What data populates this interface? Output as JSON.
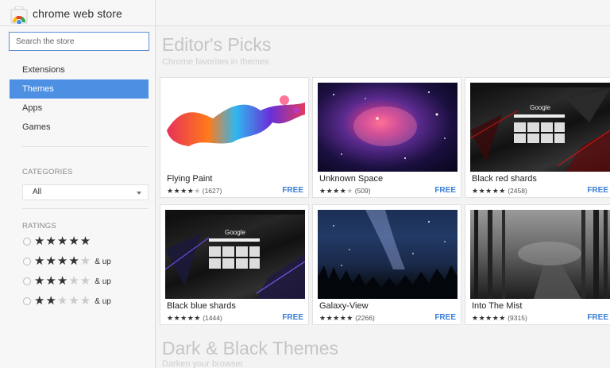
{
  "app": {
    "title": "chrome web store"
  },
  "search": {
    "placeholder": "Search the store"
  },
  "sidebar": {
    "nav": [
      "Extensions",
      "Themes",
      "Apps",
      "Games"
    ],
    "active_index": 1,
    "categories_label": "CATEGORIES",
    "category_selected": "All",
    "ratings_label": "RATINGS",
    "ratings": [
      {
        "stars": 5,
        "label": ""
      },
      {
        "stars": 4,
        "label": "& up"
      },
      {
        "stars": 3,
        "label": "& up"
      },
      {
        "stars": 2,
        "label": "& up"
      }
    ]
  },
  "sections": [
    {
      "title": "Editor's Picks",
      "subtitle": "Chrome favorites in themes"
    },
    {
      "title": "Dark & Black Themes",
      "subtitle": "Darken your browser"
    }
  ],
  "cards": [
    {
      "name": "Flying Paint",
      "rating": 4,
      "count": "(1627)",
      "price": "FREE",
      "thumb": "flying-paint-thumbnail"
    },
    {
      "name": "Unknown Space",
      "rating": 4,
      "count": "(509)",
      "price": "FREE",
      "thumb": "unknown-space-thumbnail"
    },
    {
      "name": "Black red shards",
      "rating": 4.5,
      "count": "(2458)",
      "price": "FREE",
      "thumb": "black-red-shards-thumbnail"
    },
    {
      "name": "Black blue shards",
      "rating": 4.5,
      "count": "(1444)",
      "price": "FREE",
      "thumb": "black-blue-shards-thumbnail"
    },
    {
      "name": "Galaxy-View",
      "rating": 4.5,
      "count": "(2266)",
      "price": "FREE",
      "thumb": "galaxy-view-thumbnail"
    },
    {
      "name": "Into The Mist",
      "rating": 5,
      "count": "(9315)",
      "price": "FREE",
      "thumb": "into-the-mist-thumbnail"
    }
  ],
  "thumb_text": {
    "google_word": "Google"
  }
}
